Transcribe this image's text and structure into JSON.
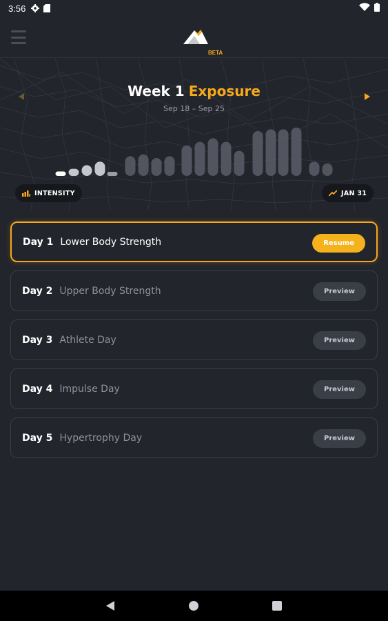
{
  "status_bar": {
    "time": "3:56",
    "icons": [
      "settings-icon",
      "sd-card-icon",
      "wifi-icon",
      "battery-icon"
    ]
  },
  "header": {
    "menu_icon": "hamburger-menu-icon",
    "logo": "mountain-logo-icon",
    "badge": "BETA"
  },
  "week": {
    "label": "Week 1",
    "phase": "Exposure",
    "dates": "Sep 18 – Sep 25",
    "prev_icon": "chevron-left-icon",
    "next_icon": "chevron-right-icon"
  },
  "intensity_bars": [
    0.05,
    0.08,
    0.12,
    0.16,
    0.03,
    0.22,
    0.24,
    0.2,
    0.22,
    0.34,
    0.38,
    0.42,
    0.38,
    0.28,
    0.5,
    0.52,
    0.52,
    0.54,
    0.16,
    0.14
  ],
  "pills": {
    "intensity_label": "INTENSITY",
    "intensity_icon": "bar-chart-icon",
    "date_label": "JAN 31",
    "date_icon": "trend-up-icon"
  },
  "days": [
    {
      "day": "Day 1",
      "name": "Lower Body Strength",
      "action": "Resume",
      "active": true
    },
    {
      "day": "Day 2",
      "name": "Upper Body Strength",
      "action": "Preview",
      "active": false
    },
    {
      "day": "Day 3",
      "name": "Athlete Day",
      "action": "Preview",
      "active": false
    },
    {
      "day": "Day 4",
      "name": "Impulse Day",
      "action": "Preview",
      "active": false
    },
    {
      "day": "Day 5",
      "name": "Hypertrophy Day",
      "action": "Preview",
      "active": false
    }
  ],
  "colors": {
    "background": "#23252c",
    "accent": "#f6a91c",
    "card_border": "#3a3d46",
    "muted_text": "#8e929c"
  },
  "nav": {
    "back_icon": "back-triangle-icon",
    "home_icon": "home-circle-icon",
    "recents_icon": "recents-square-icon"
  }
}
